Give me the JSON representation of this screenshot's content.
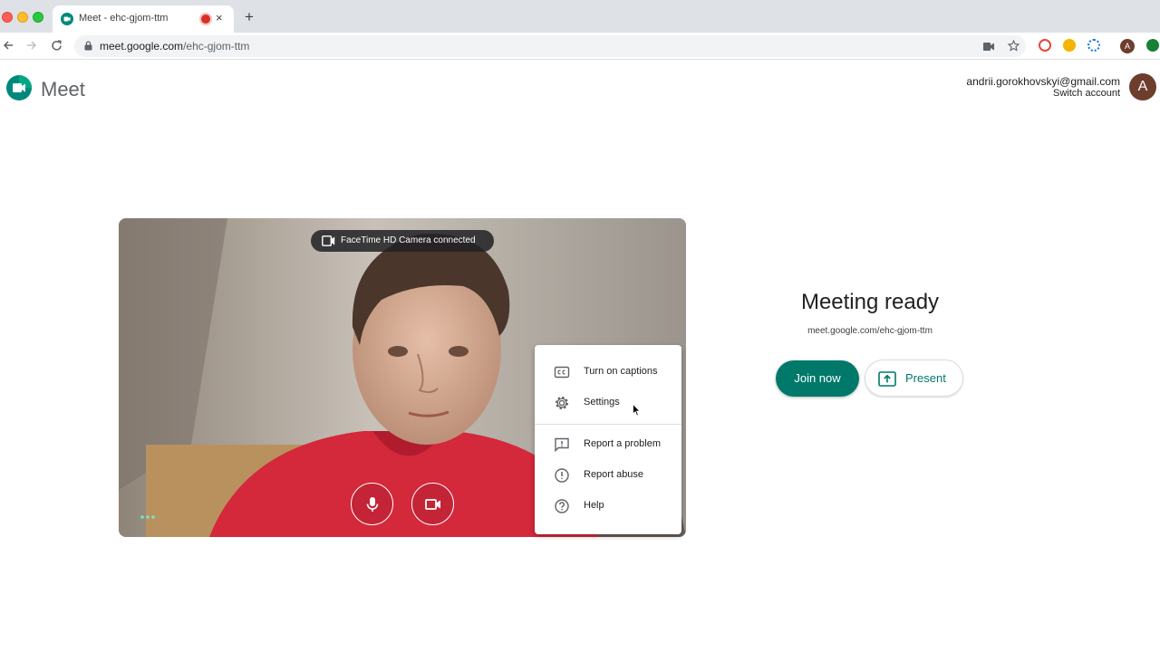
{
  "browser": {
    "tab_title": "Meet - ehc-gjom-ttm",
    "tab_close": "×",
    "new_tab": "+",
    "url_domain": "meet.google.com",
    "url_path": "/ehc-gjom-ttm",
    "profile_initial": "A"
  },
  "header": {
    "product_name": "Meet",
    "account_email": "andrii.gorokhovskyi@gmail.com",
    "switch_account": "Switch account",
    "avatar_initial": "A"
  },
  "preview": {
    "camera_status": "FaceTime HD Camera  connected"
  },
  "menu": {
    "items": [
      {
        "label": "Turn on captions",
        "icon": "captions-icon"
      },
      {
        "label": "Settings",
        "icon": "gear-icon"
      },
      {
        "label": "Report a problem",
        "icon": "feedback-icon"
      },
      {
        "label": "Report abuse",
        "icon": "alert-icon"
      },
      {
        "label": "Help",
        "icon": "help-icon"
      }
    ]
  },
  "meeting": {
    "title": "Meeting ready",
    "link": "meet.google.com/ehc-gjom-ttm",
    "join_label": "Join now",
    "present_label": "Present"
  },
  "colors": {
    "accent": "#00796b",
    "avatar": "#6d3e2d",
    "recording": "#d93025"
  }
}
